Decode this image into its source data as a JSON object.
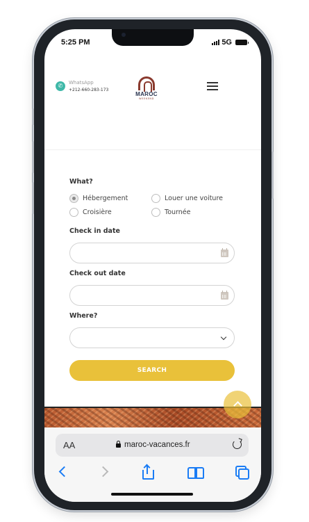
{
  "status_bar": {
    "time": "5:25 PM",
    "network": "5G"
  },
  "header": {
    "whatsapp_label": "WhatsApp",
    "whatsapp_phone": "+212-660-283-173",
    "logo_text": "MAROC",
    "logo_subtext": "WEEKEND"
  },
  "form": {
    "what_label": "What?",
    "options": [
      "Hébergement",
      "Louer une voiture",
      "Croisière",
      "Tournée"
    ],
    "selected_option": "Hébergement",
    "checkin_label": "Check in date",
    "checkin_value": "",
    "checkout_label": "Check out date",
    "checkout_value": "",
    "where_label": "Where?",
    "where_value": "",
    "search_label": "SEARCH"
  },
  "browser": {
    "text_size_label": "AA",
    "url": "maroc-vacances.fr"
  },
  "colors": {
    "accent": "#e9c13a",
    "whatsapp": "#3fb8a8",
    "brand": "#8a3a2e",
    "ios_blue": "#1a7cf5"
  }
}
